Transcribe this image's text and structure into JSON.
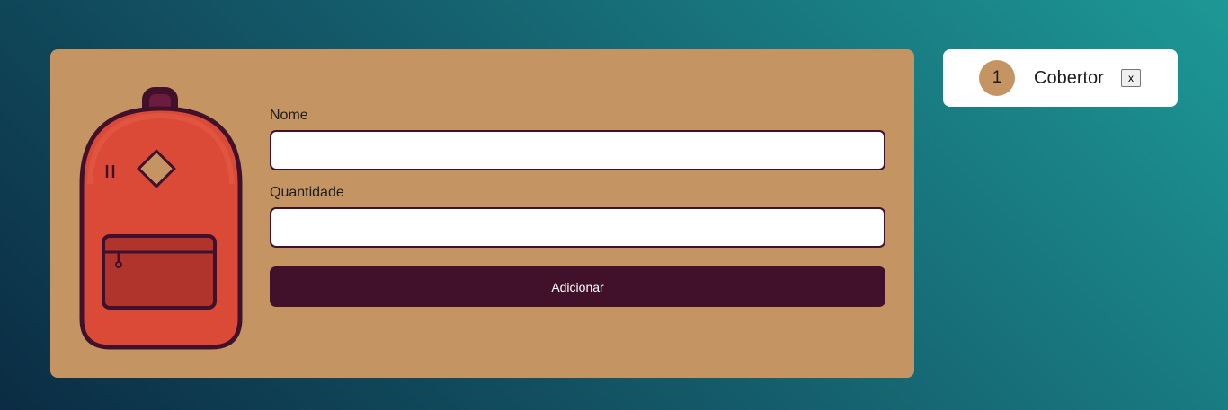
{
  "form": {
    "name_label": "Nome",
    "name_value": "",
    "quantity_label": "Quantidade",
    "quantity_value": "",
    "submit_label": "Adicionar"
  },
  "items": [
    {
      "quantity": "1",
      "name": "Cobertor",
      "remove_label": "x"
    }
  ],
  "colors": {
    "card": "#c49562",
    "accent": "#41112c",
    "backpack": "#db4a37"
  }
}
